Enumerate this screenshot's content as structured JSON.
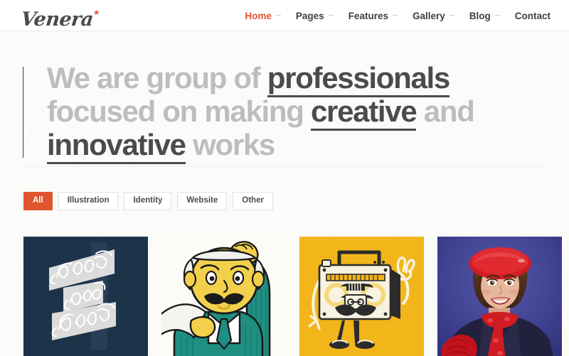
{
  "site": {
    "logo_text": "Venera",
    "logo_star": "*"
  },
  "nav": {
    "items": [
      {
        "label": "Home",
        "active": true,
        "has_dropdown": true
      },
      {
        "label": "Pages",
        "active": false,
        "has_dropdown": true
      },
      {
        "label": "Features",
        "active": false,
        "has_dropdown": true
      },
      {
        "label": "Gallery",
        "active": false,
        "has_dropdown": true
      },
      {
        "label": "Blog",
        "active": false,
        "has_dropdown": true
      },
      {
        "label": "Contact",
        "active": false,
        "has_dropdown": false
      }
    ]
  },
  "hero": {
    "line1_pre": "We are group of ",
    "line1_em": "professionals",
    "line2_pre": "focused on making ",
    "line2_em": "creative",
    "line2_post": " and",
    "line3_em": "innovative",
    "line3_post": " works"
  },
  "filters": {
    "items": [
      {
        "label": "All",
        "active": true
      },
      {
        "label": "Illustration",
        "active": false
      },
      {
        "label": "Identity",
        "active": false
      },
      {
        "label": "Website",
        "active": false
      },
      {
        "label": "Other",
        "active": false
      }
    ]
  },
  "portfolio": {
    "items": [
      {
        "name": "hold-fast-hope-typography",
        "kind": "illustration",
        "alt_text": "Hold Fast Hope",
        "bg_color": "#1d3349",
        "accent_color": "#f2f2f0",
        "words": [
          "Hold",
          "Fast",
          "Hope"
        ]
      },
      {
        "name": "mustache-man-newspaper",
        "kind": "illustration",
        "alt_text": "Cartoon gentleman reading a newspaper",
        "bg_color": "#fbfbf8",
        "skin_color": "#f2d04b",
        "suit_color": "#1f8f82",
        "line_color": "#1a1a1a"
      },
      {
        "name": "boombox-character",
        "kind": "illustration",
        "alt_text": "Boombox character with mustache",
        "bg_color": "#f2b51a",
        "body_color": "#f7f3e0",
        "line_color": "#2b2b2b"
      },
      {
        "name": "flight-attendant-portrait",
        "kind": "photo",
        "alt_text": "Woman in red beret and red scarf",
        "bg_color": "#3d3f8f",
        "accent_color": "#cf1c22",
        "skin_color": "#e8b79b"
      }
    ]
  },
  "colors": {
    "brand_orange": "#e0552e",
    "text_dark": "#4b4b4b",
    "text_muted": "#bdbdbd",
    "page_bg": "#fbfbfa",
    "border": "#e2e0dd"
  }
}
